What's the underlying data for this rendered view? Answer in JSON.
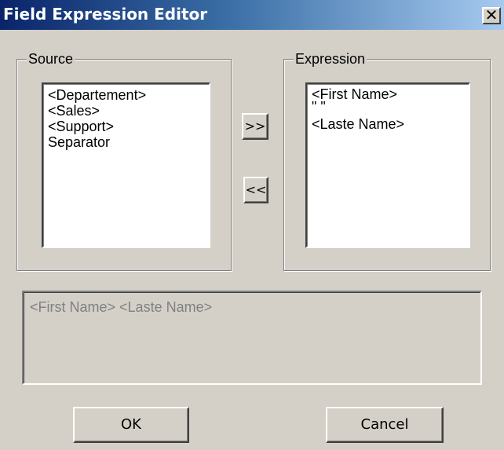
{
  "window": {
    "title": "Field Expression Editor",
    "close_glyph": "✕"
  },
  "source": {
    "label": "Source",
    "items": [
      "<Departement>",
      "<Sales>",
      "<Support>",
      "Separator"
    ]
  },
  "buttons": {
    "add": ">>",
    "remove": "<<",
    "ok": "OK",
    "cancel": "Cancel"
  },
  "expression": {
    "label": "Expression",
    "items": [
      "<First Name>",
      "\" \"",
      "<Laste Name>"
    ]
  },
  "preview": {
    "text": "<First Name> <Laste Name>"
  },
  "icons": {
    "close": "close-icon"
  }
}
